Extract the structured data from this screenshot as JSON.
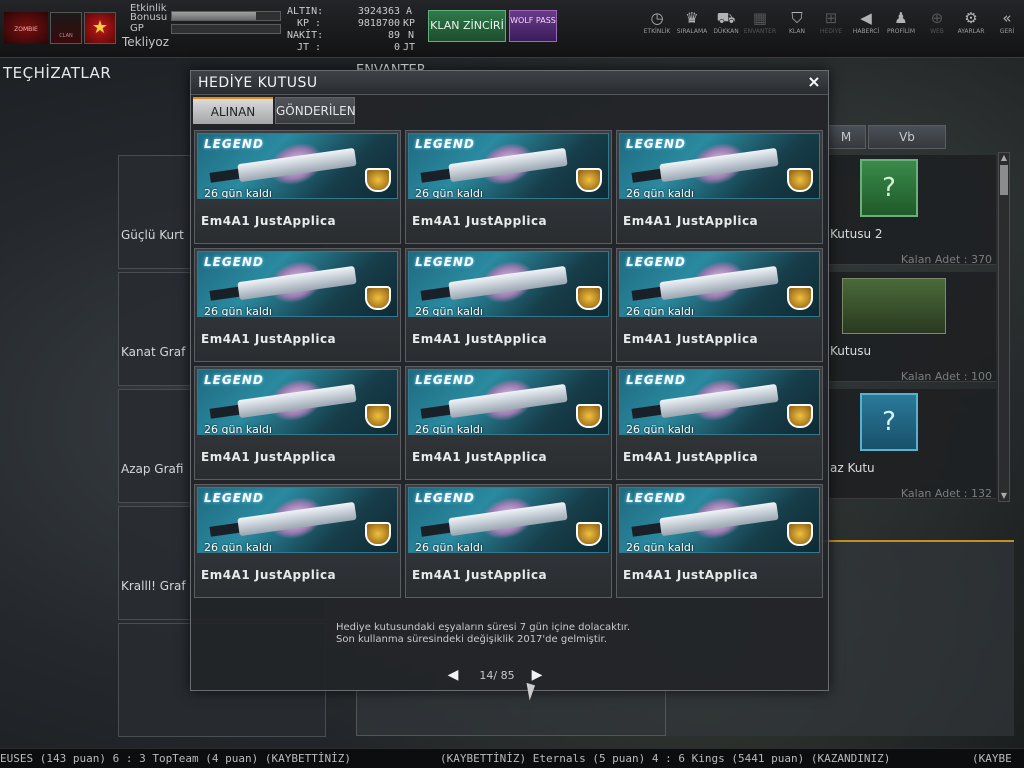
{
  "topbar": {
    "player_label": "Tekliyoz",
    "etkinlik_label": "Etkinlik",
    "bonusu_label": "Bonusu",
    "gp_label": "GP",
    "bonus_progress": 0.78,
    "gp_progress": 0.0,
    "currencies": [
      {
        "label": "ALTIN:",
        "value": "3924363",
        "unit": "A"
      },
      {
        "label": "KP :",
        "value": "9818700",
        "unit": "KP"
      },
      {
        "label": "NAKİT:",
        "value": "89",
        "unit": "N"
      },
      {
        "label": "JT :",
        "value": "0",
        "unit": "JT"
      }
    ],
    "klan_button": "KLAN ZİNCİRİ",
    "wolf_pass": "WOLF PASS",
    "nav": [
      {
        "icon": "clock-icon",
        "glyph": "◷",
        "label": "ETKİNLİK",
        "dim": false
      },
      {
        "icon": "rank-icon",
        "glyph": "♛",
        "label": "SIRALAMA",
        "dim": false
      },
      {
        "icon": "cart-icon",
        "glyph": "⛟",
        "label": "DÜKKAN",
        "dim": false
      },
      {
        "icon": "inventory-icon",
        "glyph": "▦",
        "label": "ENVANTER",
        "dim": true
      },
      {
        "icon": "shield-icon",
        "glyph": "⛉",
        "label": "KLAN",
        "dim": false
      },
      {
        "icon": "gift-icon",
        "glyph": "⊞",
        "label": "HEDİYE",
        "dim": true
      },
      {
        "icon": "megaphone-icon",
        "glyph": "◀",
        "label": "HABERCİ",
        "dim": false
      },
      {
        "icon": "profile-icon",
        "glyph": "♟",
        "label": "PROFİLİM",
        "dim": false
      },
      {
        "icon": "globe-icon",
        "glyph": "⊕",
        "label": "WEB",
        "dim": true
      },
      {
        "icon": "gear-icon",
        "glyph": "⚙",
        "label": "AYARLAR",
        "dim": false
      },
      {
        "icon": "back-icon",
        "glyph": "«",
        "label": "GERİ",
        "dim": false
      }
    ]
  },
  "left": {
    "title": "TEÇHİZATLAR",
    "cards": [
      "Güçlü Kurt",
      "Kanat Graf",
      "Azap Grafi",
      "Kralll! Graf",
      ""
    ]
  },
  "inventory": {
    "title": "ENVANTER",
    "tabs": [
      "M",
      "Vb"
    ],
    "items": [
      {
        "name": "Kutusu 2",
        "count": "Kalan Adet : 370"
      },
      {
        "name": "Kutusu",
        "count": "Kalan Adet : 100"
      },
      {
        "name": "az Kutu",
        "count": "Kalan Adet : 132"
      }
    ]
  },
  "dialog": {
    "title": "HEDİYE KUTUSU",
    "close": "×",
    "tabs": {
      "received": "ALINAN",
      "sent": "GÖNDERİLEN"
    },
    "items": [
      {
        "tier": "LEGEND",
        "days": "26 gün kaldı",
        "name": "Em4A1 JustApplica"
      },
      {
        "tier": "LEGEND",
        "days": "26 gün kaldı",
        "name": "Em4A1 JustApplica"
      },
      {
        "tier": "LEGEND",
        "days": "26 gün kaldı",
        "name": "Em4A1 JustApplica"
      },
      {
        "tier": "LEGEND",
        "days": "26 gün kaldı",
        "name": "Em4A1 JustApplica"
      },
      {
        "tier": "LEGEND",
        "days": "26 gün kaldı",
        "name": "Em4A1 JustApplica"
      },
      {
        "tier": "LEGEND",
        "days": "26 gün kaldı",
        "name": "Em4A1 JustApplica"
      },
      {
        "tier": "LEGEND",
        "days": "26 gün kaldı",
        "name": "Em4A1 JustApplica"
      },
      {
        "tier": "LEGEND",
        "days": "26 gün kaldı",
        "name": "Em4A1 JustApplica"
      },
      {
        "tier": "LEGEND",
        "days": "26 gün kaldı",
        "name": "Em4A1 JustApplica"
      },
      {
        "tier": "LEGEND",
        "days": "26 gün kaldı",
        "name": "Em4A1 JustApplica"
      },
      {
        "tier": "LEGEND",
        "days": "26 gün kaldı",
        "name": "Em4A1 JustApplica"
      },
      {
        "tier": "LEGEND",
        "days": "26 gün kaldı",
        "name": "Em4A1 JustApplica"
      }
    ],
    "note_line1": "Hediye kutusundaki eşyaların süresi 7 gün içine dolacaktır.",
    "note_line2": "Son kullanma süresindeki değişiklik 2017'de gelmiştir.",
    "pager": {
      "prev": "◀",
      "next": "▶",
      "text": "14/ 85"
    }
  },
  "ticker": {
    "segments": [
      "EUSES (143 puan) 6 : 3 TopTeam (4 puan) (KAYBETTİNİZ)",
      "(KAYBETTİNİZ) Eternals (5 puan) 4 : 6 Kings (5441 puan) (KAZANDINIZ)",
      "(KAYBE"
    ]
  }
}
